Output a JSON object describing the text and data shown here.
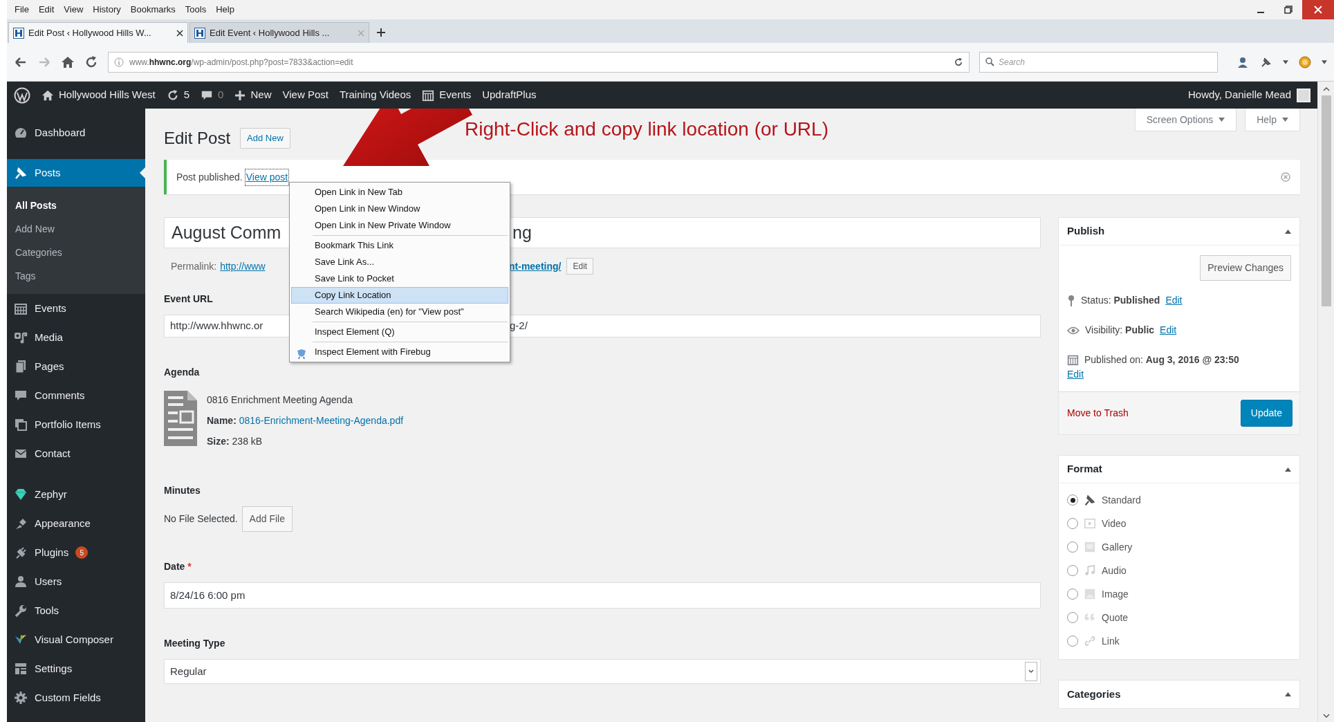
{
  "menu_bar": [
    "File",
    "Edit",
    "View",
    "History",
    "Bookmarks",
    "Tools",
    "Help"
  ],
  "tabs": [
    {
      "title": "Edit Post ‹ Hollywood Hills W...",
      "selected": true
    },
    {
      "title": "Edit Event ‹ Hollywood Hills ...",
      "selected": false
    }
  ],
  "address_bar": {
    "url": "www.**hhwnc.org**/wp-admin/post.php?post=7833&action=edit"
  },
  "search": {
    "placeholder": "Search"
  },
  "admin_bar": {
    "items": [
      {
        "text": "Hollywood Hills West"
      },
      {
        "text": "5"
      },
      {
        "text": "0"
      },
      {
        "text": "New"
      },
      {
        "text": "View Post"
      },
      {
        "text": "Training Videos"
      },
      {
        "text": "Events"
      },
      {
        "text": "UpdraftPlus"
      }
    ],
    "greeting": "Howdy, Danielle Mead"
  },
  "sidebar": {
    "items": [
      {
        "label": "Dashboard",
        "selected": false
      },
      {
        "label": "Posts",
        "selected": true,
        "children": [
          {
            "label": "All Posts",
            "selected": true
          },
          {
            "label": "Add New",
            "selected": false
          },
          {
            "label": "Categories",
            "selected": false
          },
          {
            "label": "Tags",
            "selected": false
          }
        ]
      },
      {
        "label": "Events",
        "selected": false
      },
      {
        "label": "Media",
        "selected": false
      },
      {
        "label": "Pages",
        "selected": false
      },
      {
        "label": "Comments",
        "selected": false
      },
      {
        "label": "Portfolio Items",
        "selected": false
      },
      {
        "label": "Contact",
        "selected": false
      },
      {
        "label": "Zephyr",
        "selected": false
      },
      {
        "label": "Appearance",
        "selected": false
      },
      {
        "label": "Plugins",
        "selected": false,
        "badge": "5"
      },
      {
        "label": "Users",
        "selected": false
      },
      {
        "label": "Tools",
        "selected": false
      },
      {
        "label": "Visual Composer",
        "selected": false
      },
      {
        "label": "Settings",
        "selected": false
      },
      {
        "label": "Custom Fields",
        "selected": false
      }
    ]
  },
  "annotation": {
    "text": "Right-Click and copy link location (or URL)"
  },
  "page": {
    "title": "Edit Post",
    "add_new": "Add New",
    "screen_options": "Screen Options",
    "help": "Help"
  },
  "notice": {
    "text": "Post published.",
    "link": "View post"
  },
  "post": {
    "title_start": "August Comm",
    "title_end": "ng",
    "permalink_label": "Permalink:",
    "permalink_start": "http://www",
    "permalink_end": "nt-meeting/",
    "permalink_edit": "Edit"
  },
  "event_url": {
    "label": "Event URL",
    "value_start": "http://www.hhwnc.or",
    "value_end": "g-2/"
  },
  "agenda": {
    "label": "Agenda",
    "file_title": "0816 Enrichment Meeting Agenda",
    "name_label": "Name:",
    "file_name": "0816-Enrichment-Meeting-Agenda.pdf",
    "size_label": "Size:",
    "size": "238 kB"
  },
  "minutes": {
    "label": "Minutes",
    "status": "No File Selected.",
    "button": "Add File"
  },
  "date": {
    "label": "Date",
    "required_mark": "*",
    "value": "8/24/16 6:00 pm"
  },
  "meeting_type": {
    "label": "Meeting Type",
    "value": "Regular"
  },
  "context_menu": {
    "items": [
      {
        "label": "Open Link in New Tab",
        "selected": false,
        "separator_before": false
      },
      {
        "label": "Open Link in New Window",
        "selected": false,
        "separator_before": false
      },
      {
        "label": "Open Link in New Private Window",
        "selected": false,
        "separator_before": false
      },
      {
        "label": "Bookmark This Link",
        "selected": false,
        "separator_before": true
      },
      {
        "label": "Save Link As...",
        "selected": false,
        "separator_before": false
      },
      {
        "label": "Save Link to Pocket",
        "selected": false,
        "separator_before": false
      },
      {
        "label": "Copy Link Location",
        "selected": true,
        "separator_before": false
      },
      {
        "label": "Search Wikipedia (en) for \"View post\"",
        "selected": false,
        "separator_before": false
      },
      {
        "label": "Inspect Element (Q)",
        "selected": false,
        "separator_before": true
      },
      {
        "label": "Inspect Element with Firebug",
        "selected": false,
        "separator_before": true
      }
    ]
  },
  "publish": {
    "title": "Publish",
    "preview": "Preview Changes",
    "status": "Status: **Published**",
    "status_edit": "Edit",
    "visibility": "Visibility: **Public**",
    "visibility_edit": "Edit",
    "published": "Published on: **Aug 3, 2016 @ 23:50**",
    "published_edit": "Edit",
    "trash": "Move to Trash",
    "update": "Update"
  },
  "format": {
    "title": "Format",
    "options": [
      {
        "label": "Standard",
        "selected": true
      },
      {
        "label": "Video",
        "selected": false
      },
      {
        "label": "Gallery",
        "selected": false
      },
      {
        "label": "Audio",
        "selected": false
      },
      {
        "label": "Image",
        "selected": false
      },
      {
        "label": "Quote",
        "selected": false
      },
      {
        "label": "Link",
        "selected": false
      }
    ]
  },
  "categories": {
    "title": "Categories"
  }
}
